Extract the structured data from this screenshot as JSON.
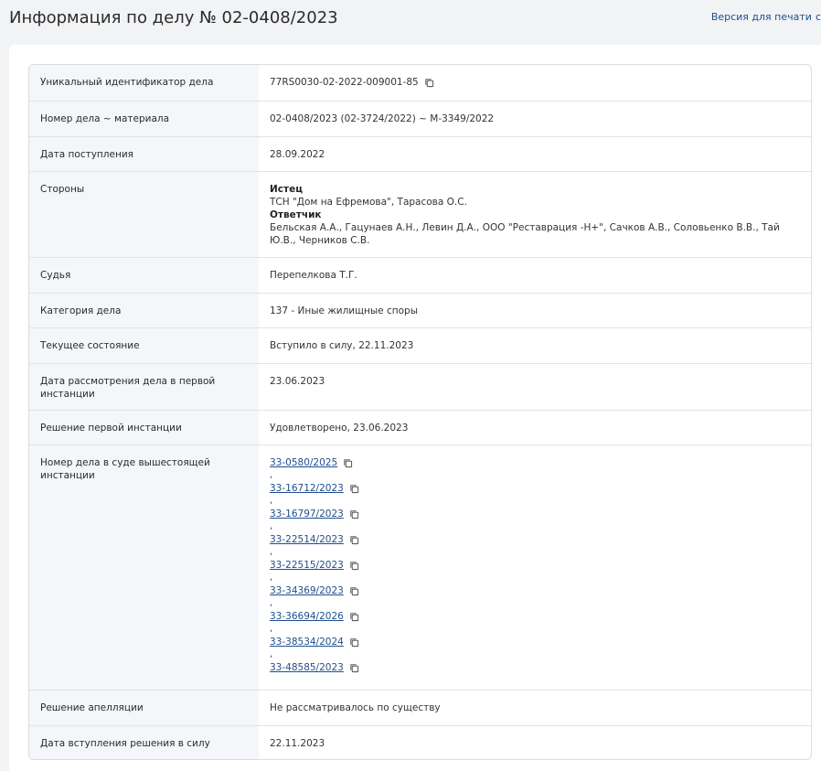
{
  "header": {
    "title": "Информация по делу № 02-0408/2023",
    "print_label": "Версия для печати",
    "print_tail": "с"
  },
  "rows": [
    {
      "label": "Уникальный идентификатор дела",
      "value": "77RS0030-02-2022-009001-85"
    },
    {
      "label": "Номер дела ~ материала",
      "value": "02-0408/2023 (02-3724/2022) ~ М-3349/2022"
    },
    {
      "label": "Дата поступления",
      "value": "28.09.2022"
    },
    {
      "label": "Стороны"
    },
    {
      "label": "Судья",
      "value": "Перепелкова Т.Г."
    },
    {
      "label": "Категория дела",
      "value": "137 - Иные жилищные споры"
    },
    {
      "label": "Текущее состояние",
      "value": "Вступило в силу, 22.11.2023"
    },
    {
      "label": "Дата рассмотрения дела в первой инстанции",
      "value": "23.06.2023"
    },
    {
      "label": "Решение первой инстанции",
      "value": "Удовлетворено, 23.06.2023"
    },
    {
      "label": "Номер дела в суде вышестоящей инстанции"
    },
    {
      "label": "Решение апелляции",
      "value": "Не рассматривалось по существу"
    },
    {
      "label": "Дата вступления решения в силу",
      "value": "22.11.2023"
    }
  ],
  "parties": {
    "plaintiff_label": "Истец",
    "plaintiff": "ТСН \"Дом на Ефремова\", Тарасова О.С.",
    "defendant_label": "Ответчик",
    "defendant": "Бельская А.А., Гацунаев А.Н., Левин Д.А., ООО \"Реставрация -Н+\", Сачков А.В., Соловьенко В.В., Тай Ю.В., Черников С.В."
  },
  "higher_cases": [
    "33-0580/2025",
    "33-16712/2023",
    "33-16797/2023",
    "33-22514/2023",
    "33-22515/2023",
    "33-34369/2023",
    "33-36694/2026",
    "33-38534/2024",
    "33-48585/2023"
  ],
  "separator": ",",
  "icons": {
    "copy": "copy-icon"
  }
}
